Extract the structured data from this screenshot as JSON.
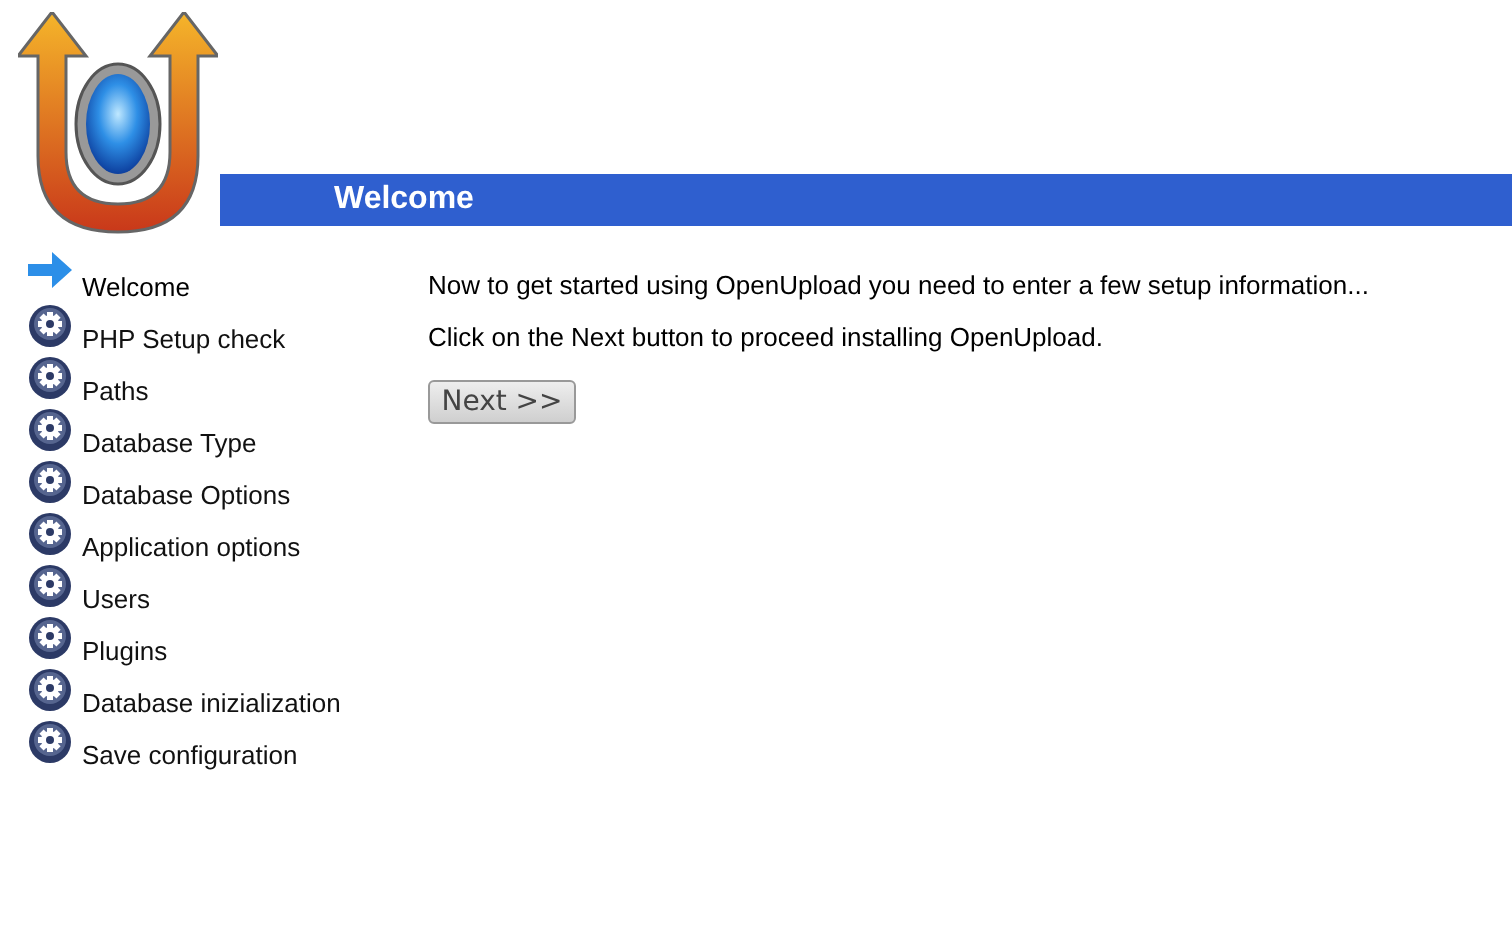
{
  "header": {
    "title": "Welcome"
  },
  "steps": [
    {
      "label": "Welcome",
      "selected": true
    },
    {
      "label": "PHP Setup check",
      "selected": false
    },
    {
      "label": "Paths",
      "selected": false
    },
    {
      "label": "Database Type",
      "selected": false
    },
    {
      "label": "Database Options",
      "selected": false
    },
    {
      "label": "Application options",
      "selected": false
    },
    {
      "label": "Users",
      "selected": false
    },
    {
      "label": "Plugins",
      "selected": false
    },
    {
      "label": "Database inizialization",
      "selected": false
    },
    {
      "label": "Save configuration",
      "selected": false
    }
  ],
  "content": {
    "paragraphs": [
      "Now to get started using OpenUpload you need to enter a few setup information...",
      "Click on the Next button to proceed installing OpenUpload."
    ],
    "button": "Next >>"
  }
}
